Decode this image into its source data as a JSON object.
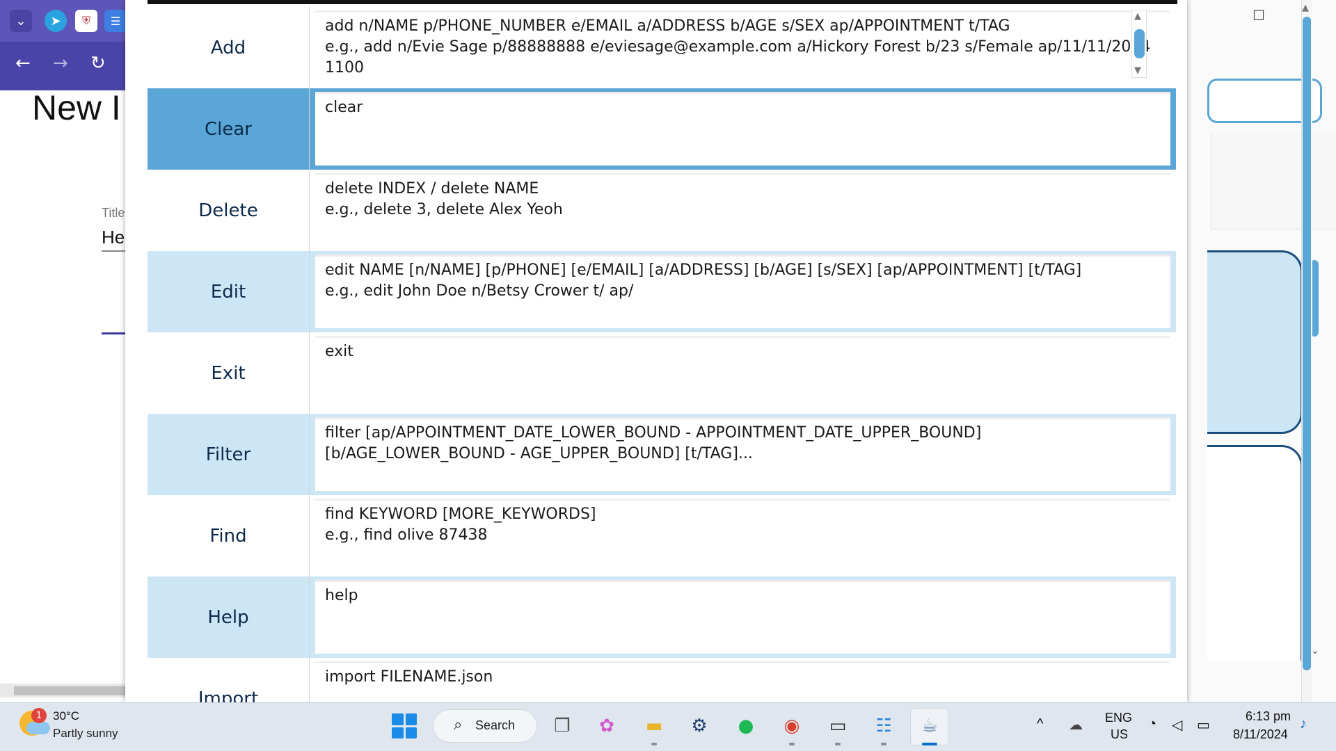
{
  "background_browser": {
    "heading": "New I",
    "title_label": "Title",
    "title_value": "Hel",
    "nav": {
      "back": "←",
      "forward": "→",
      "reload": "↻"
    }
  },
  "help_window": {
    "rows": [
      {
        "command": "Add",
        "description": "add n/NAME p/PHONE_NUMBER e/EMAIL a/ADDRESS b/AGE s/SEX ap/APPOINTMENT t/TAG\ne.g., add n/Evie Sage p/88888888 e/eviesage@example.com a/Hickory Forest b/23 s/Female ap/11/11/2024 1100",
        "style": "white"
      },
      {
        "command": "Clear",
        "description": "clear",
        "style": "selected"
      },
      {
        "command": "Delete",
        "description": "delete INDEX / delete NAME\ne.g., delete 3, delete Alex Yeoh",
        "style": "white"
      },
      {
        "command": "Edit",
        "description": "edit NAME [n/NAME] [p/PHONE] [e/EMAIL] [a/ADDRESS] [b/AGE] [s/SEX] [ap/APPOINTMENT] [t/TAG]\ne.g., edit John Doe n/Betsy Crower t/ ap/",
        "style": "light"
      },
      {
        "command": "Exit",
        "description": "exit",
        "style": "white"
      },
      {
        "command": "Filter",
        "description": "filter [ap/APPOINTMENT_DATE_LOWER_BOUND - APPOINTMENT_DATE_UPPER_BOUND]\n[b/AGE_LOWER_BOUND - AGE_UPPER_BOUND] [t/TAG]...",
        "style": "light"
      },
      {
        "command": "Find",
        "description": "find KEYWORD [MORE_KEYWORDS]\ne.g., find olive 87438",
        "style": "white"
      },
      {
        "command": "Help",
        "description": "help",
        "style": "light"
      },
      {
        "command": "Import",
        "description": "import FILENAME.json",
        "style": "white"
      }
    ]
  },
  "taskbar": {
    "weather_badge": "1",
    "weather_temp": "30°C",
    "weather_desc": "Partly sunny",
    "search_label": "Search",
    "language_line1": "ENG",
    "language_line2": "US",
    "time": "6:13 pm",
    "date": "8/11/2024"
  },
  "colors": {
    "selected_row": "#5aa6d6",
    "light_row": "#cce6f6",
    "accent_blue": "#1a8ce8",
    "browser_purple": "#5e55b8"
  }
}
